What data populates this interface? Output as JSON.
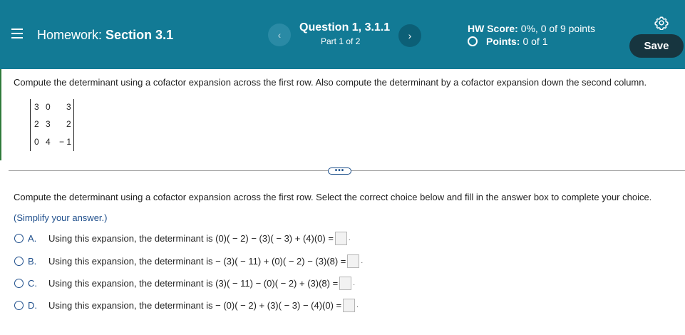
{
  "header": {
    "homework_prefix": "Homework:",
    "homework_section": "Section 3.1",
    "question_title": "Question 1, 3.1.1",
    "question_part": "Part 1 of 2",
    "hw_score_label": "HW Score:",
    "hw_score_value": "0%, 0 of 9 points",
    "points_label": "Points:",
    "points_value": "0 of 1",
    "save_label": "Save",
    "prev_symbol": "‹",
    "next_symbol": "›",
    "color": "#127a95"
  },
  "problem": {
    "prompt": "Compute the determinant using a cofactor expansion across the first row. Also compute the determinant by a cofactor expansion down the second column.",
    "matrix": [
      [
        "3",
        "0",
        "3"
      ],
      [
        "2",
        "3",
        "2"
      ],
      [
        "0",
        "4",
        "− 1"
      ]
    ]
  },
  "divider": {
    "dots": "•••"
  },
  "part": {
    "instruction": "Compute the determinant using a cofactor expansion across the first row. Select the correct choice below and fill in the answer box to complete your choice.",
    "simplify": "(Simplify your answer.)",
    "choices": [
      {
        "letter": "A.",
        "text": "Using this expansion, the determinant is (0)( − 2) − (3)( − 3) + (4)(0) ="
      },
      {
        "letter": "B.",
        "text": "Using this expansion, the determinant is  − (3)( − 11) + (0)( − 2) − (3)(8) ="
      },
      {
        "letter": "C.",
        "text": "Using this expansion, the determinant is (3)( − 11) − (0)( − 2) + (3)(8) ="
      },
      {
        "letter": "D.",
        "text": "Using this expansion, the determinant is  − (0)( − 2) + (3)( − 3) − (4)(0) ="
      }
    ]
  }
}
